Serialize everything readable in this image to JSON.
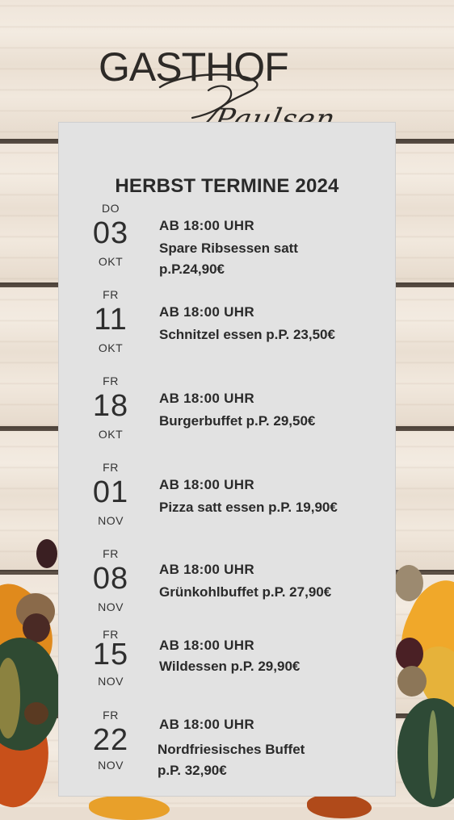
{
  "logo": {
    "line1": "GASTHOF",
    "line2": "Paulsen"
  },
  "heading": "HERBST TERMINE 2024",
  "events": [
    {
      "dow": "DO",
      "day": "03",
      "month": "OKT",
      "time": "AB 18:00 UHR",
      "description": "Spare Ribsessen satt\np.P.24,90€"
    },
    {
      "dow": "FR",
      "day": "11",
      "month": "OKT",
      "time": "AB 18:00 UHR",
      "description": "Schnitzel essen p.P. 23,50€"
    },
    {
      "dow": "FR",
      "day": "18",
      "month": "OKT",
      "time": "AB 18:00 UHR",
      "description": "Burgerbuffet p.P. 29,50€"
    },
    {
      "dow": "FR",
      "day": "01",
      "month": "NOV",
      "time": "AB 18:00 UHR",
      "description": "Pizza satt essen p.P. 19,90€"
    },
    {
      "dow": "FR",
      "day": "08",
      "month": "NOV",
      "time": "AB 18:00 UHR",
      "description": "Grünkohlbuffet p.P. 27,90€"
    },
    {
      "dow": "FR",
      "day": "15",
      "month": "NOV",
      "time": "AB 18:00 UHR",
      "description": "Wildessen p.P. 29,90€"
    },
    {
      "dow": "FR",
      "day": "22",
      "month": "NOV",
      "time": "AB 18:00 UHR",
      "description": "Nordfriesisches Buffet\n p.P. 32,90€"
    }
  ],
  "colors": {
    "card": "#e2e2e2",
    "text": "#2a2a2a",
    "wood": "#efe5da"
  }
}
